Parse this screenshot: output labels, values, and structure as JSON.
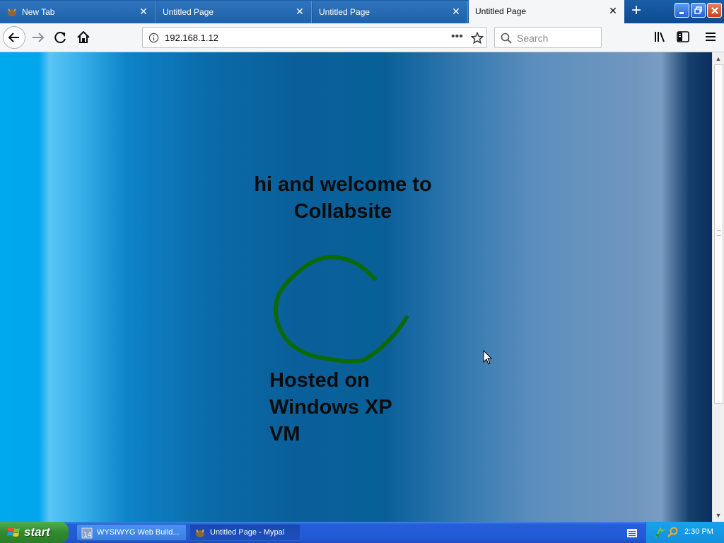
{
  "browser": {
    "tabs": [
      {
        "label": "New Tab",
        "icon": "firefox-icon",
        "active": false
      },
      {
        "label": "Untitled Page",
        "active": false
      },
      {
        "label": "Untitled Page",
        "active": false
      },
      {
        "label": "Untitled Page",
        "active": true
      }
    ],
    "new_tab_symbol": "+",
    "close_symbol": "✕",
    "url": "192.168.1.12",
    "search_placeholder": "Search",
    "url_more": "•••"
  },
  "page": {
    "heading": "hi and welcome to Collabsite",
    "hosted_text": "Hosted on Windows XP VM",
    "scribble_color": "#0a6a0a"
  },
  "taskbar": {
    "start_label": "start",
    "items": [
      {
        "label": "WYSIWYG Web Build...",
        "icon": "wysiwyg-app-icon",
        "active": false
      },
      {
        "label": "Untitled Page - Mypal",
        "icon": "mypal-icon",
        "active": true
      }
    ],
    "clock": "2:30 PM"
  },
  "colors": {
    "accent": "#245edb",
    "start_green": "#318a2f"
  }
}
